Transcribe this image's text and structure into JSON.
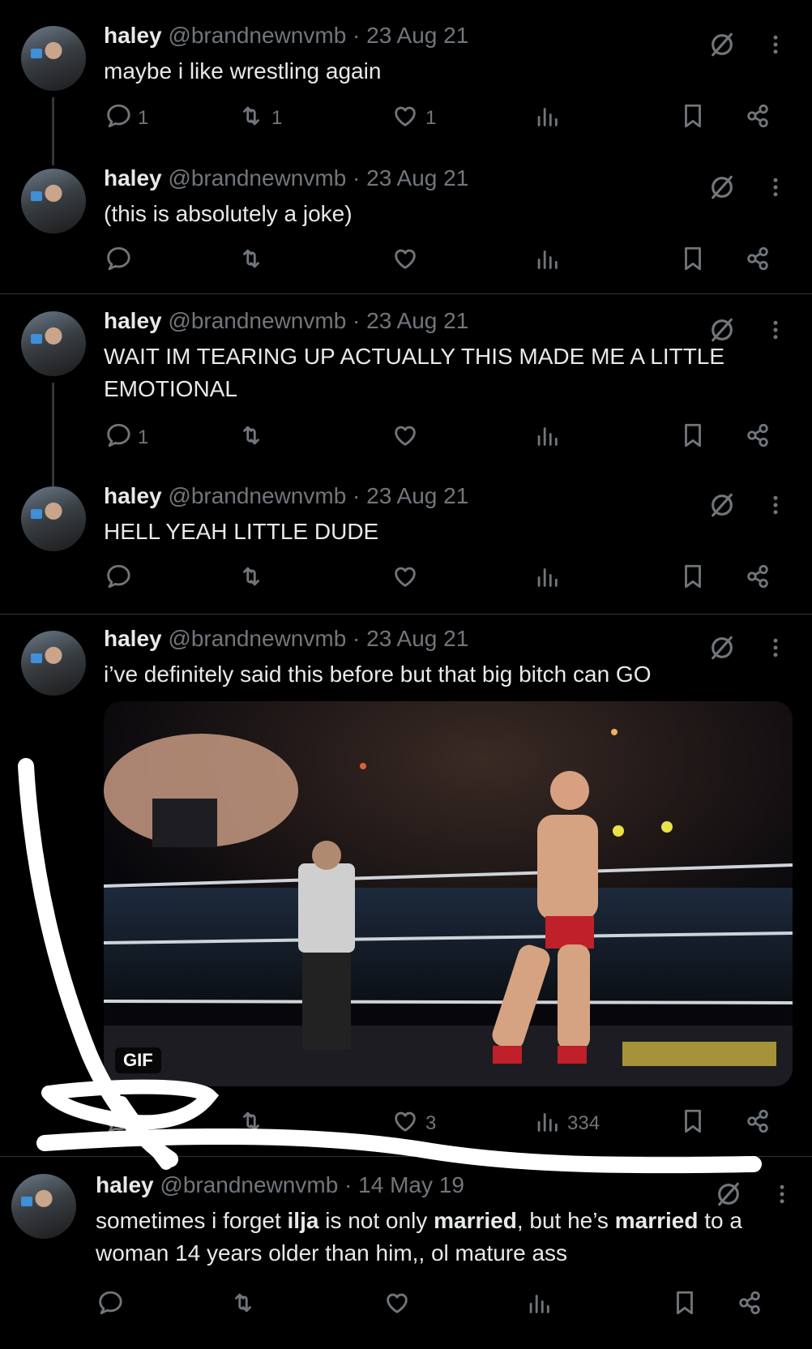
{
  "tweets": [
    {
      "name": "haley",
      "handle": "@brandnewnvmb",
      "date": "· 23 Aug 21",
      "text": "maybe i like wrestling again",
      "replies": "1",
      "reposts": "1",
      "likes": "1",
      "views": ""
    },
    {
      "name": "haley",
      "handle": "@brandnewnvmb",
      "date": "· 23 Aug 21",
      "text": "(this is absolutely a joke)",
      "replies": "",
      "reposts": "",
      "likes": "",
      "views": ""
    },
    {
      "name": "haley",
      "handle": "@brandnewnvmb",
      "date": "· 23 Aug 21",
      "text": "WAIT IM TEARING UP ACTUALLY THIS MADE ME A LITTLE EMOTIONAL",
      "replies": "1",
      "reposts": "",
      "likes": "",
      "views": ""
    },
    {
      "name": "haley",
      "handle": "@brandnewnvmb",
      "date": "· 23 Aug 21",
      "text": "HELL YEAH LITTLE DUDE",
      "replies": "",
      "reposts": "",
      "likes": "",
      "views": ""
    },
    {
      "name": "haley",
      "handle": "@brandnewnvmb",
      "date": "· 23 Aug 21",
      "text": "i’ve definitely said this before but that big bitch can GO",
      "media_badge": "GIF",
      "replies": "",
      "reposts": "",
      "likes": "3",
      "views": "334"
    },
    {
      "name": "haley",
      "handle": "@brandnewnvmb",
      "date": "· 14 May 19",
      "text_parts": [
        {
          "t": "sometimes i forget ",
          "bold": false
        },
        {
          "t": "ilja",
          "bold": true
        },
        {
          "t": " is not only ",
          "bold": false
        },
        {
          "t": "married",
          "bold": true
        },
        {
          "t": ", but he’s ",
          "bold": false
        },
        {
          "t": "married",
          "bold": true
        },
        {
          "t": " to a woman 14 years older than him,, ol mature ass",
          "bold": false
        }
      ],
      "replies": "",
      "reposts": "",
      "likes": "",
      "views": ""
    }
  ],
  "icons": {
    "reply": "reply-icon",
    "repost": "repost-icon",
    "like": "heart-icon",
    "views": "views-icon",
    "bookmark": "bookmark-icon",
    "share": "share-icon",
    "grok": "grok-icon",
    "more": "more-icon"
  },
  "colors": {
    "background": "#000000",
    "text": "#e7e9ea",
    "muted": "#71767b",
    "divider": "#2f3336",
    "scribble": "#ffffff"
  }
}
